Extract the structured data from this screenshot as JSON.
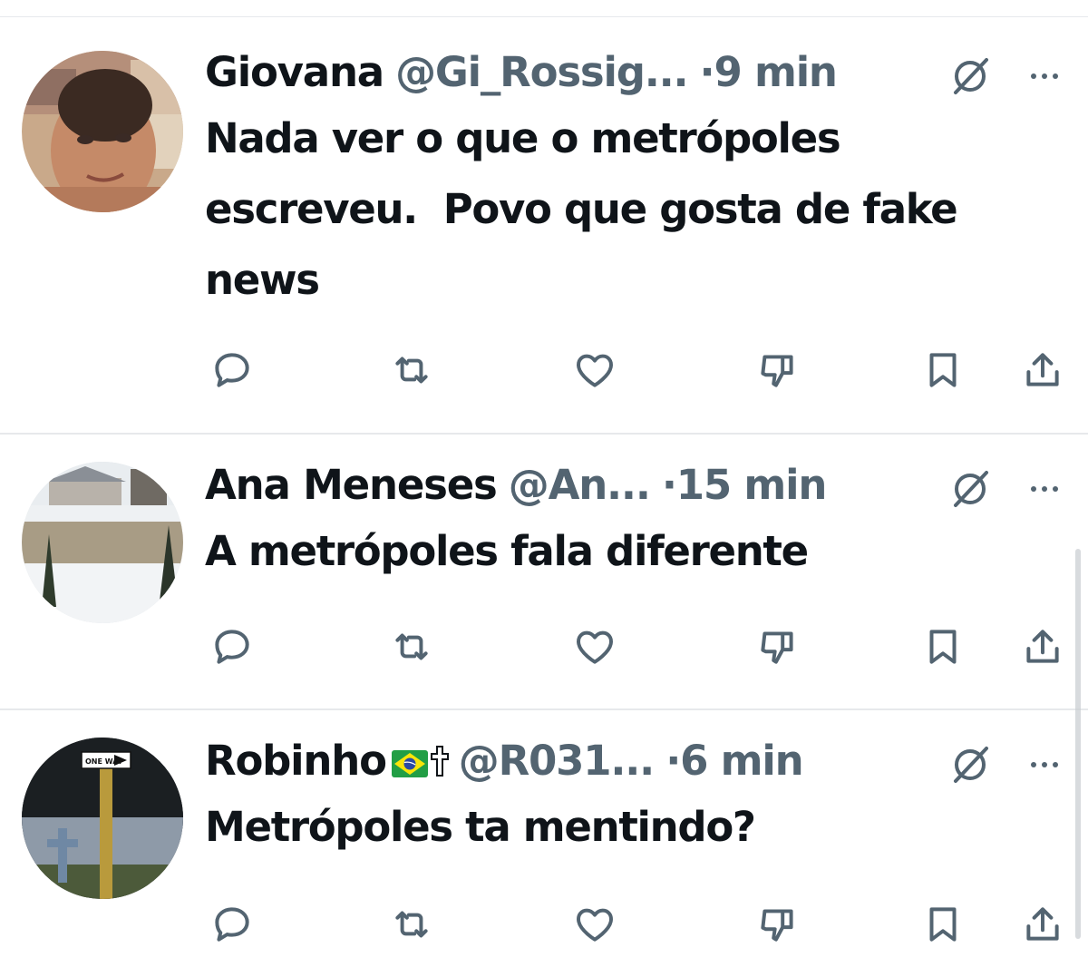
{
  "tweets": [
    {
      "name": "Giovana",
      "handle": "@Gi_Rossig...",
      "separator": "·",
      "time": "9 min",
      "text": "Nada ver o que o metrópoles\nescreveu.  Povo que gosta de fake\nnews",
      "avatar": "woman-selfie-avatar"
    },
    {
      "name": "Ana Meneses",
      "handle": "@An...",
      "separator": "·",
      "time": "15 min",
      "text": "A metrópoles fala diferente",
      "avatar": "snowy-yard-avatar"
    },
    {
      "name": "Robinho",
      "emojis": [
        "🇧🇷",
        "✝"
      ],
      "handle": "@R031...",
      "separator": "·",
      "time": "6 min",
      "text": "Metrópoles ta mentindo?",
      "avatar": "one-way-sign-avatar",
      "sign_text": "ONE WAY"
    }
  ],
  "icons": {
    "reply": "reply-icon",
    "retweet": "retweet-icon",
    "like": "heart-icon",
    "dislike": "thumbs-down-icon",
    "bookmark": "bookmark-icon",
    "share": "share-icon",
    "grok": "grok-icon",
    "more": "more-icon"
  },
  "colors": {
    "text": "#0f1419",
    "secondary": "#536471",
    "divider": "#e7e9eb"
  }
}
